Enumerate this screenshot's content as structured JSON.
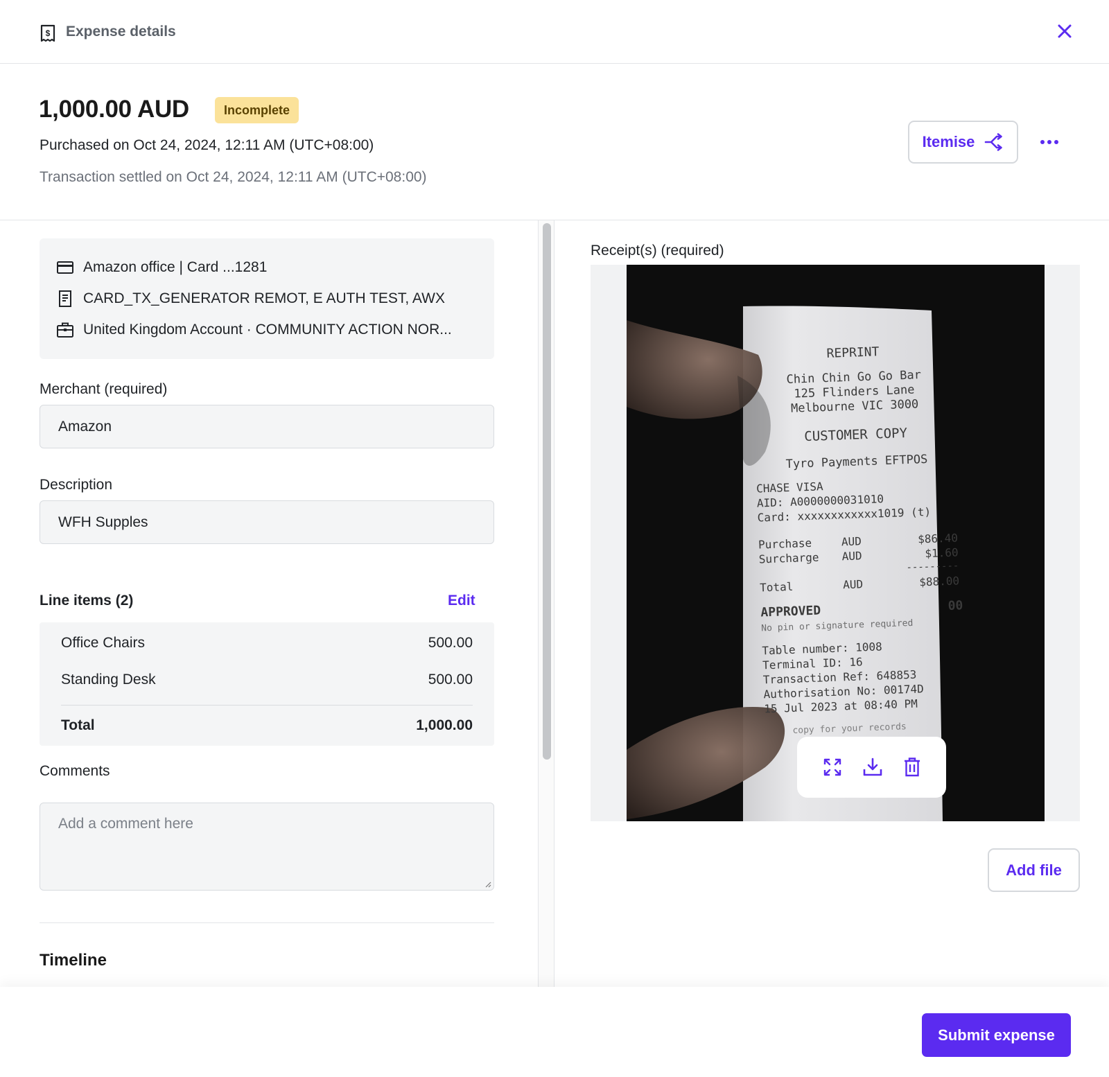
{
  "header": {
    "title": "Expense details"
  },
  "summary": {
    "amount": "1,000.00 AUD",
    "status": "Incomplete",
    "purchased": "Purchased on Oct 24, 2024, 12:11 AM (UTC+08:00)",
    "settled": "Transaction settled on Oct 24, 2024, 12:11 AM (UTC+08:00)",
    "itemise_label": "Itemise"
  },
  "details": {
    "card": "Amazon office | Card ...1281",
    "statement": "CARD_TX_GENERATOR REMOT, E AUTH TEST, AWX",
    "account": "United Kingdom Account · COMMUNITY ACTION NOR..."
  },
  "merchant": {
    "label": "Merchant (required)",
    "value": "Amazon"
  },
  "description": {
    "label": "Description",
    "value": "WFH Supples"
  },
  "line_items": {
    "title": "Line items (2)",
    "edit_label": "Edit",
    "items": [
      {
        "name": "Office Chairs",
        "amount": "500.00"
      },
      {
        "name": "Standing Desk",
        "amount": "500.00"
      }
    ],
    "total_label": "Total",
    "total_value": "1,000.00"
  },
  "comments": {
    "label": "Comments",
    "placeholder": "Add a comment here"
  },
  "timeline": {
    "title": "Timeline"
  },
  "receipts": {
    "label": "Receipt(s) (required)",
    "add_file_label": "Add file",
    "receipt_lines": {
      "reprint": "REPRINT",
      "merchant": "Chin Chin Go Go Bar",
      "street": "125 Flinders Lane",
      "city": "Melbourne VIC 3000",
      "copy": "CUSTOMER COPY",
      "provider": "Tyro Payments EFTPOS",
      "card_type": "CHASE VISA",
      "aid": "AID: A0000000031010",
      "card": "Card: xxxxxxxxxxxx1019 (t)",
      "purchase_label": "Purchase",
      "purchase_cur": "AUD",
      "purchase_amt": "$86.40",
      "surcharge_label": "Surcharge",
      "surcharge_cur": "AUD",
      "surcharge_amt": "$1.60",
      "dashes": "---------",
      "total_label": "Total",
      "total_cur": "AUD",
      "total_amt": "$88.00",
      "approved": "APPROVED",
      "code": "00",
      "no_pin": "No pin or signature required",
      "table": "Table number: 1008",
      "terminal": "Terminal ID: 16",
      "ref": "Transaction Ref: 648853",
      "auth": "Authorisation No: 00174D",
      "date": "15 Jul 2023 at 08:40 PM",
      "keep": "copy for your records"
    }
  },
  "footer": {
    "submit_label": "Submit expense"
  },
  "colors": {
    "accent": "#5b2bf0",
    "badge_bg": "#fbe29a",
    "panel_bg": "#f4f5f6"
  },
  "icons": [
    "receipt-dollar-icon",
    "close-icon",
    "itemise-split-icon",
    "more-horizontal-icon",
    "credit-card-icon",
    "document-icon",
    "briefcase-icon",
    "expand-icon",
    "download-icon",
    "trash-icon"
  ]
}
